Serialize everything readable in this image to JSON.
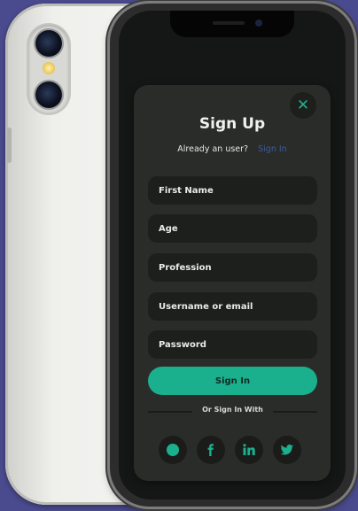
{
  "form": {
    "title": "Sign Up",
    "already_user_text": "Already an user?",
    "sign_in_link": "Sign In",
    "close_glyph": "✕",
    "fields": [
      {
        "placeholder": "First Name"
      },
      {
        "placeholder": "Age"
      },
      {
        "placeholder": "Profession"
      },
      {
        "placeholder": "Username or email"
      },
      {
        "placeholder": "Password"
      }
    ],
    "submit_label": "Sign In",
    "divider_text": "Or Sign In With",
    "social_icons": [
      "google-icon",
      "facebook-icon",
      "linkedin-icon",
      "twitter-icon"
    ]
  },
  "colors": {
    "background": "#4a4a8e",
    "card": "#2a2c29",
    "field": "#1d1f1c",
    "accent": "#1ab08e",
    "link": "#3c5a9a"
  }
}
